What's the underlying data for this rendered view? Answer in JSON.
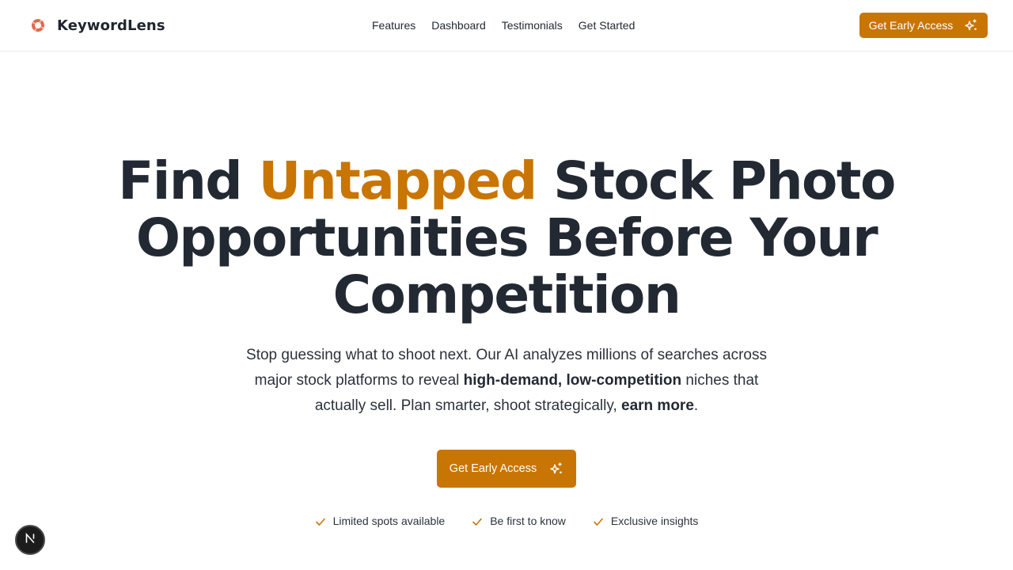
{
  "brand": {
    "name": "KeywordLens",
    "icon": "lifebuoy-icon",
    "icon_color": "#e8654a"
  },
  "nav": {
    "items": [
      {
        "label": "Features"
      },
      {
        "label": "Dashboard"
      },
      {
        "label": "Testimonials"
      },
      {
        "label": "Get Started"
      }
    ],
    "cta_label": "Get Early Access"
  },
  "hero": {
    "title_pre": "Find ",
    "title_accent": "Untapped",
    "title_post": " Stock Photo Opportunities Before Your Competition",
    "subtitle_1": "Stop guessing what to shoot next. Our AI analyzes millions of searches across major stock platforms to reveal ",
    "subtitle_bold_1": "high-demand, low-competition",
    "subtitle_2": " niches that actually sell. Plan smarter, shoot strategically, ",
    "subtitle_bold_2": "earn more",
    "subtitle_3": ".",
    "cta_label": "Get Early Access"
  },
  "features": [
    {
      "label": "Limited spots available"
    },
    {
      "label": "Be first to know"
    },
    {
      "label": "Exclusive insights"
    }
  ],
  "colors": {
    "accent": "#c97504",
    "text": "#232933"
  }
}
